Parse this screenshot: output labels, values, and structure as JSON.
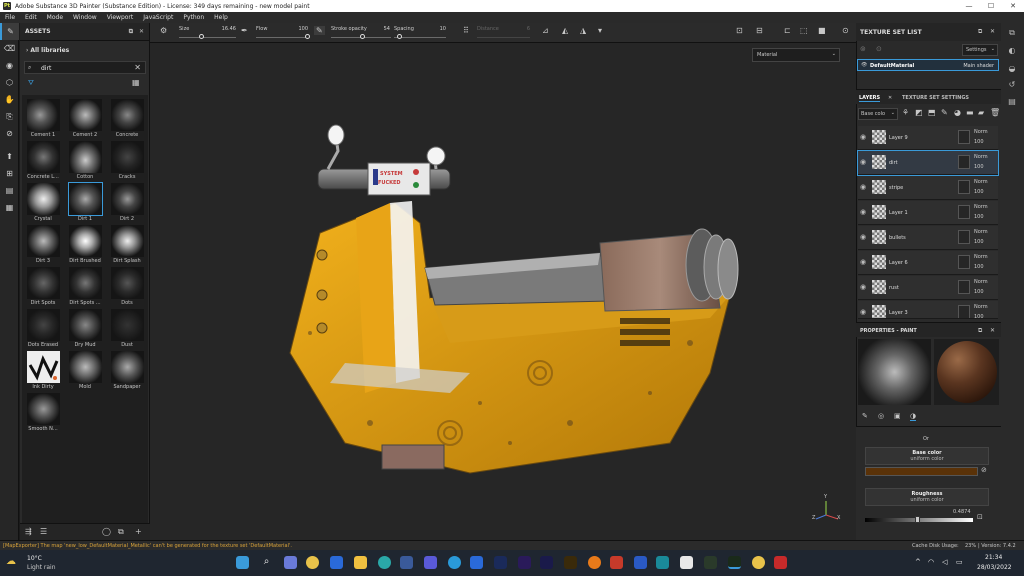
{
  "window": {
    "title": "Adobe Substance 3D Painter (Substance Edition) - License: 349 days remaining - new model paint",
    "app_icon": "Pt",
    "min": "—",
    "max": "☐",
    "close": "✕"
  },
  "menu": [
    "File",
    "Edit",
    "Mode",
    "Window",
    "Viewport",
    "JavaScript",
    "Python",
    "Help"
  ],
  "toolbar": {
    "size_label": "Size",
    "size_value": "16.46",
    "flow_label": "Flow",
    "flow_value": "100",
    "stroke_label": "Stroke opacity",
    "stroke_value": "54",
    "spacing_label": "Spacing",
    "spacing_value": "10",
    "distance_label": "Distance",
    "distance_value": "6"
  },
  "assets": {
    "title": "ASSETS",
    "breadcrumb": "All libraries",
    "search_value": "dirt",
    "items": [
      "Cement 1",
      "Cement 2",
      "Concrete",
      "Concrete L...",
      "Cotton",
      "Cracks",
      "Crystal",
      "Dirt 1",
      "Dirt 2",
      "Dirt 3",
      "Dirt Brushed",
      "Dirt Splash",
      "Dirt Spots",
      "Dirt Spots ...",
      "Dots",
      "Dots Erased",
      "Dry Mud",
      "Dust",
      "Ink Dirty",
      "Mold",
      "Sandpaper",
      "Smooth N..."
    ],
    "selected": "Dirt 1"
  },
  "viewport": {
    "mode_dropdown": "Material",
    "decal_top": "SYSTEM",
    "decal_bottom": "FUCKED",
    "gizmo_x": "X",
    "gizmo_y": "Y",
    "gizmo_z": "Z"
  },
  "texture_set_list": {
    "title": "TEXTURE SET LIST",
    "settings_label": "Settings",
    "material": "DefaultMaterial",
    "shader": "Main shader"
  },
  "layers_panel": {
    "tab_layers": "LAYERS",
    "tab_tss": "TEXTURE SET SETTINGS",
    "channel": "Base colo",
    "layers": [
      {
        "name": "Layer 9",
        "blend": "Norm",
        "opacity": "100"
      },
      {
        "name": "dirt",
        "blend": "Norm",
        "opacity": "100"
      },
      {
        "name": "stripe",
        "blend": "Norm",
        "opacity": "100"
      },
      {
        "name": "Layer 1",
        "blend": "Norm",
        "opacity": "100"
      },
      {
        "name": "bullets",
        "blend": "Norm",
        "opacity": "100"
      },
      {
        "name": "Layer 6",
        "blend": "Norm",
        "opacity": "100"
      },
      {
        "name": "rust",
        "blend": "Norm",
        "opacity": "100"
      },
      {
        "name": "Layer 3",
        "blend": "Norm",
        "opacity": "100"
      }
    ]
  },
  "properties": {
    "title": "PROPERTIES - PAINT",
    "or_label": "Or",
    "base_color_label": "Base color",
    "base_color_sub": "uniform color",
    "base_color_hex": "#5a3208",
    "roughness_label": "Roughness",
    "roughness_sub": "uniform color",
    "roughness_value": "0.4874",
    "roughness_fraction": 0.4874
  },
  "status": {
    "message": "[MapExporter] The map 'new_low_DefaultMaterial_Metallic' can't be generated for the texture set 'DefaultMaterial'.",
    "cache": "Cache Disk Usage:",
    "cache_pct": "23%",
    "version": "| Version: 7.4.2"
  },
  "taskbar": {
    "temp": "10°C",
    "weather": "Light rain",
    "time": "21:34",
    "date": "28/03/2022"
  },
  "colors": {
    "accent": "#3a9ad9",
    "status_warn": "#d9a33a",
    "scooter_yellow": "#e8a417"
  }
}
